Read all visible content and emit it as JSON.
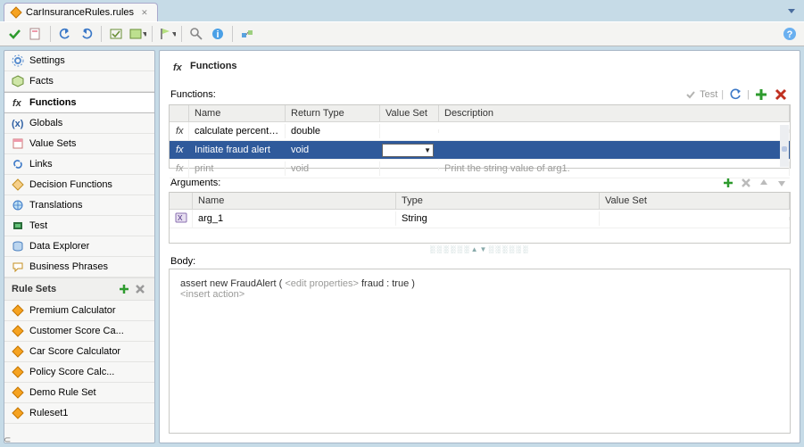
{
  "tab": {
    "title": "CarInsuranceRules.rules"
  },
  "sidebar": {
    "items": [
      {
        "label": "Settings",
        "icon": "gear"
      },
      {
        "label": "Facts",
        "icon": "facts"
      },
      {
        "label": "Functions",
        "icon": "fx",
        "selected": true
      },
      {
        "label": "Globals",
        "icon": "globals"
      },
      {
        "label": "Value Sets",
        "icon": "valuesets"
      },
      {
        "label": "Links",
        "icon": "links"
      },
      {
        "label": "Decision Functions",
        "icon": "decision"
      },
      {
        "label": "Translations",
        "icon": "translations"
      },
      {
        "label": "Test",
        "icon": "test"
      },
      {
        "label": "Data Explorer",
        "icon": "dataexplorer"
      },
      {
        "label": "Business Phrases",
        "icon": "phrases"
      }
    ],
    "rulesets_header": "Rule Sets",
    "rulesets": [
      {
        "label": "Premium Calculator"
      },
      {
        "label": "Customer Score Ca..."
      },
      {
        "label": "Car Score Calculator"
      },
      {
        "label": "Policy Score Calc..."
      },
      {
        "label": "Demo Rule Set"
      },
      {
        "label": "Ruleset1"
      }
    ]
  },
  "main": {
    "title": "Functions",
    "functions": {
      "label": "Functions:",
      "test_label": "Test",
      "columns": [
        "",
        "Name",
        "Return Type",
        "Value Set",
        "Description"
      ],
      "rows": [
        {
          "name": "calculate percent po...",
          "return": "double",
          "valueset": "",
          "desc": "",
          "state": "normal"
        },
        {
          "name": "Initiate fraud alert",
          "return": "void",
          "valueset": "",
          "desc": "",
          "state": "selected"
        },
        {
          "name": "print",
          "return": "void",
          "valueset": "",
          "desc": "Print the string value of arg1.",
          "state": "disabled"
        }
      ]
    },
    "arguments": {
      "label": "Arguments:",
      "columns": [
        "",
        "Name",
        "Type",
        "Value Set"
      ],
      "rows": [
        {
          "name": "arg_1",
          "type": "String",
          "valueset": ""
        }
      ]
    },
    "body": {
      "label": "Body:",
      "line1a": "assert new FraudAlert (  ",
      "line1b": "<edit properties>",
      "line1c": "  fraud : true  )",
      "line2": "<insert action>"
    }
  }
}
